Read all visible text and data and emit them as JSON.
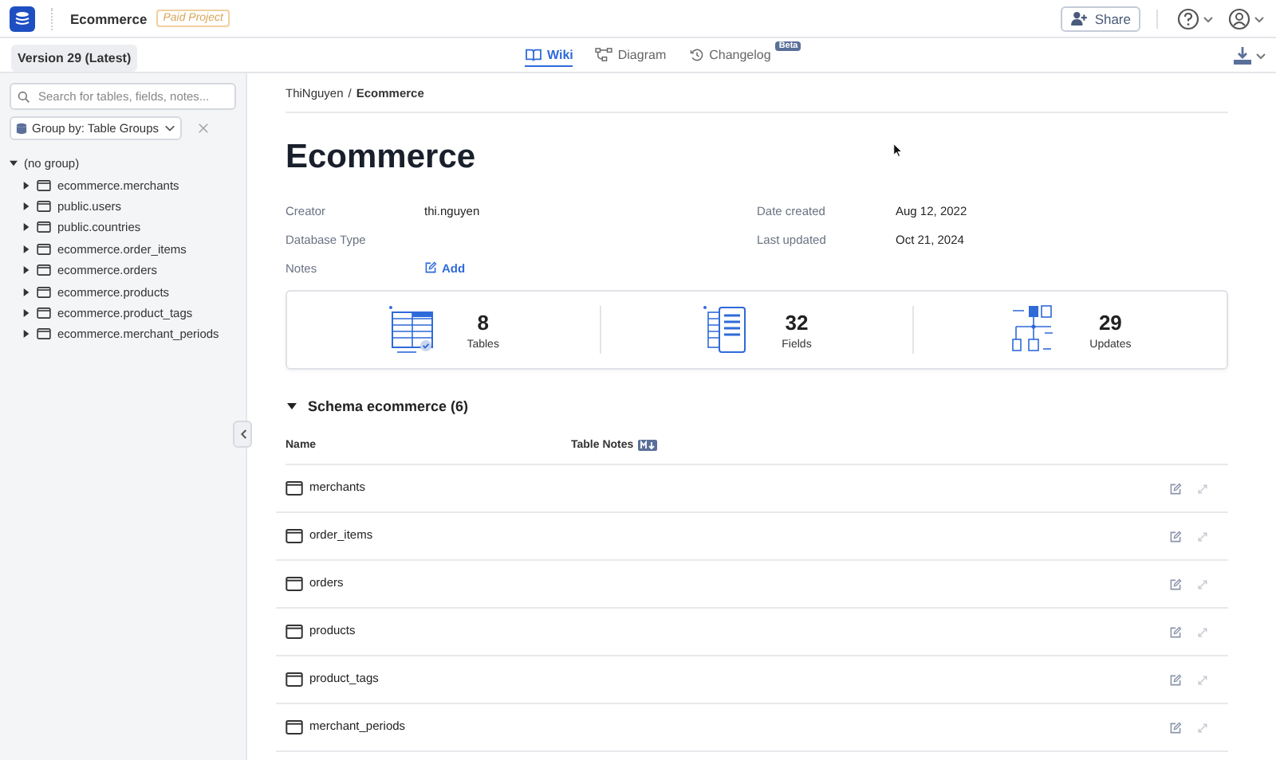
{
  "header": {
    "project_title": "Ecommerce",
    "badge": "Paid Project",
    "share_button": "Share"
  },
  "toolbar": {
    "version": "Version 29 (Latest)",
    "tabs": [
      {
        "label": "Wiki",
        "kind": "book",
        "selected": true
      },
      {
        "label": "Diagram",
        "kind": "diagram",
        "selected": false
      },
      {
        "label": "Changelog",
        "kind": "history",
        "selected": false,
        "badge": "Beta"
      }
    ]
  },
  "sidebar": {
    "search": {
      "placeholder": "Search for tables, fields, notes..."
    },
    "group_by": "Group by: Table Groups",
    "tree": [
      {
        "label": "(no group)",
        "expanded": true,
        "children": [
          {
            "label": "ecommerce.merchants",
            "expanded": false
          },
          {
            "label": "public.users",
            "expanded": false
          },
          {
            "label": "public.countries",
            "expanded": false
          },
          {
            "label": "ecommerce.order_items",
            "expanded": false
          },
          {
            "label": "ecommerce.orders",
            "expanded": false
          },
          {
            "label": "ecommerce.products",
            "expanded": false
          },
          {
            "label": "ecommerce.product_tags",
            "expanded": false
          },
          {
            "label": "ecommerce.merchant_periods",
            "expanded": false
          }
        ]
      }
    ]
  },
  "breadcrumb": {
    "owner": "ThiNguyen",
    "separator": "/",
    "current": "Ecommerce"
  },
  "title": "Ecommerce",
  "meta_left": [
    {
      "label": "Creator",
      "value": "thi.nguyen"
    },
    {
      "label": "Database Type"
    },
    {
      "label": "Notes",
      "action": "Add"
    }
  ],
  "meta_right": [
    {
      "label": "Date created",
      "value": "Aug 12, 2022"
    },
    {
      "label": "Last updated",
      "value": "Oct 21, 2024"
    }
  ],
  "stats": [
    {
      "kind": "tables",
      "value": "8",
      "label": "Tables"
    },
    {
      "kind": "fields",
      "value": "32",
      "label": "Fields"
    },
    {
      "kind": "updates",
      "value": "29",
      "label": "Updates"
    }
  ],
  "schema": {
    "title": "Schema ecommerce (6)",
    "expanded": true,
    "columns": [
      "Name",
      "Table Notes"
    ],
    "rows": [
      {
        "name": "merchants"
      },
      {
        "name": "order_items"
      },
      {
        "name": "orders"
      },
      {
        "name": "products"
      },
      {
        "name": "product_tags"
      },
      {
        "name": "merchant_periods"
      }
    ]
  }
}
